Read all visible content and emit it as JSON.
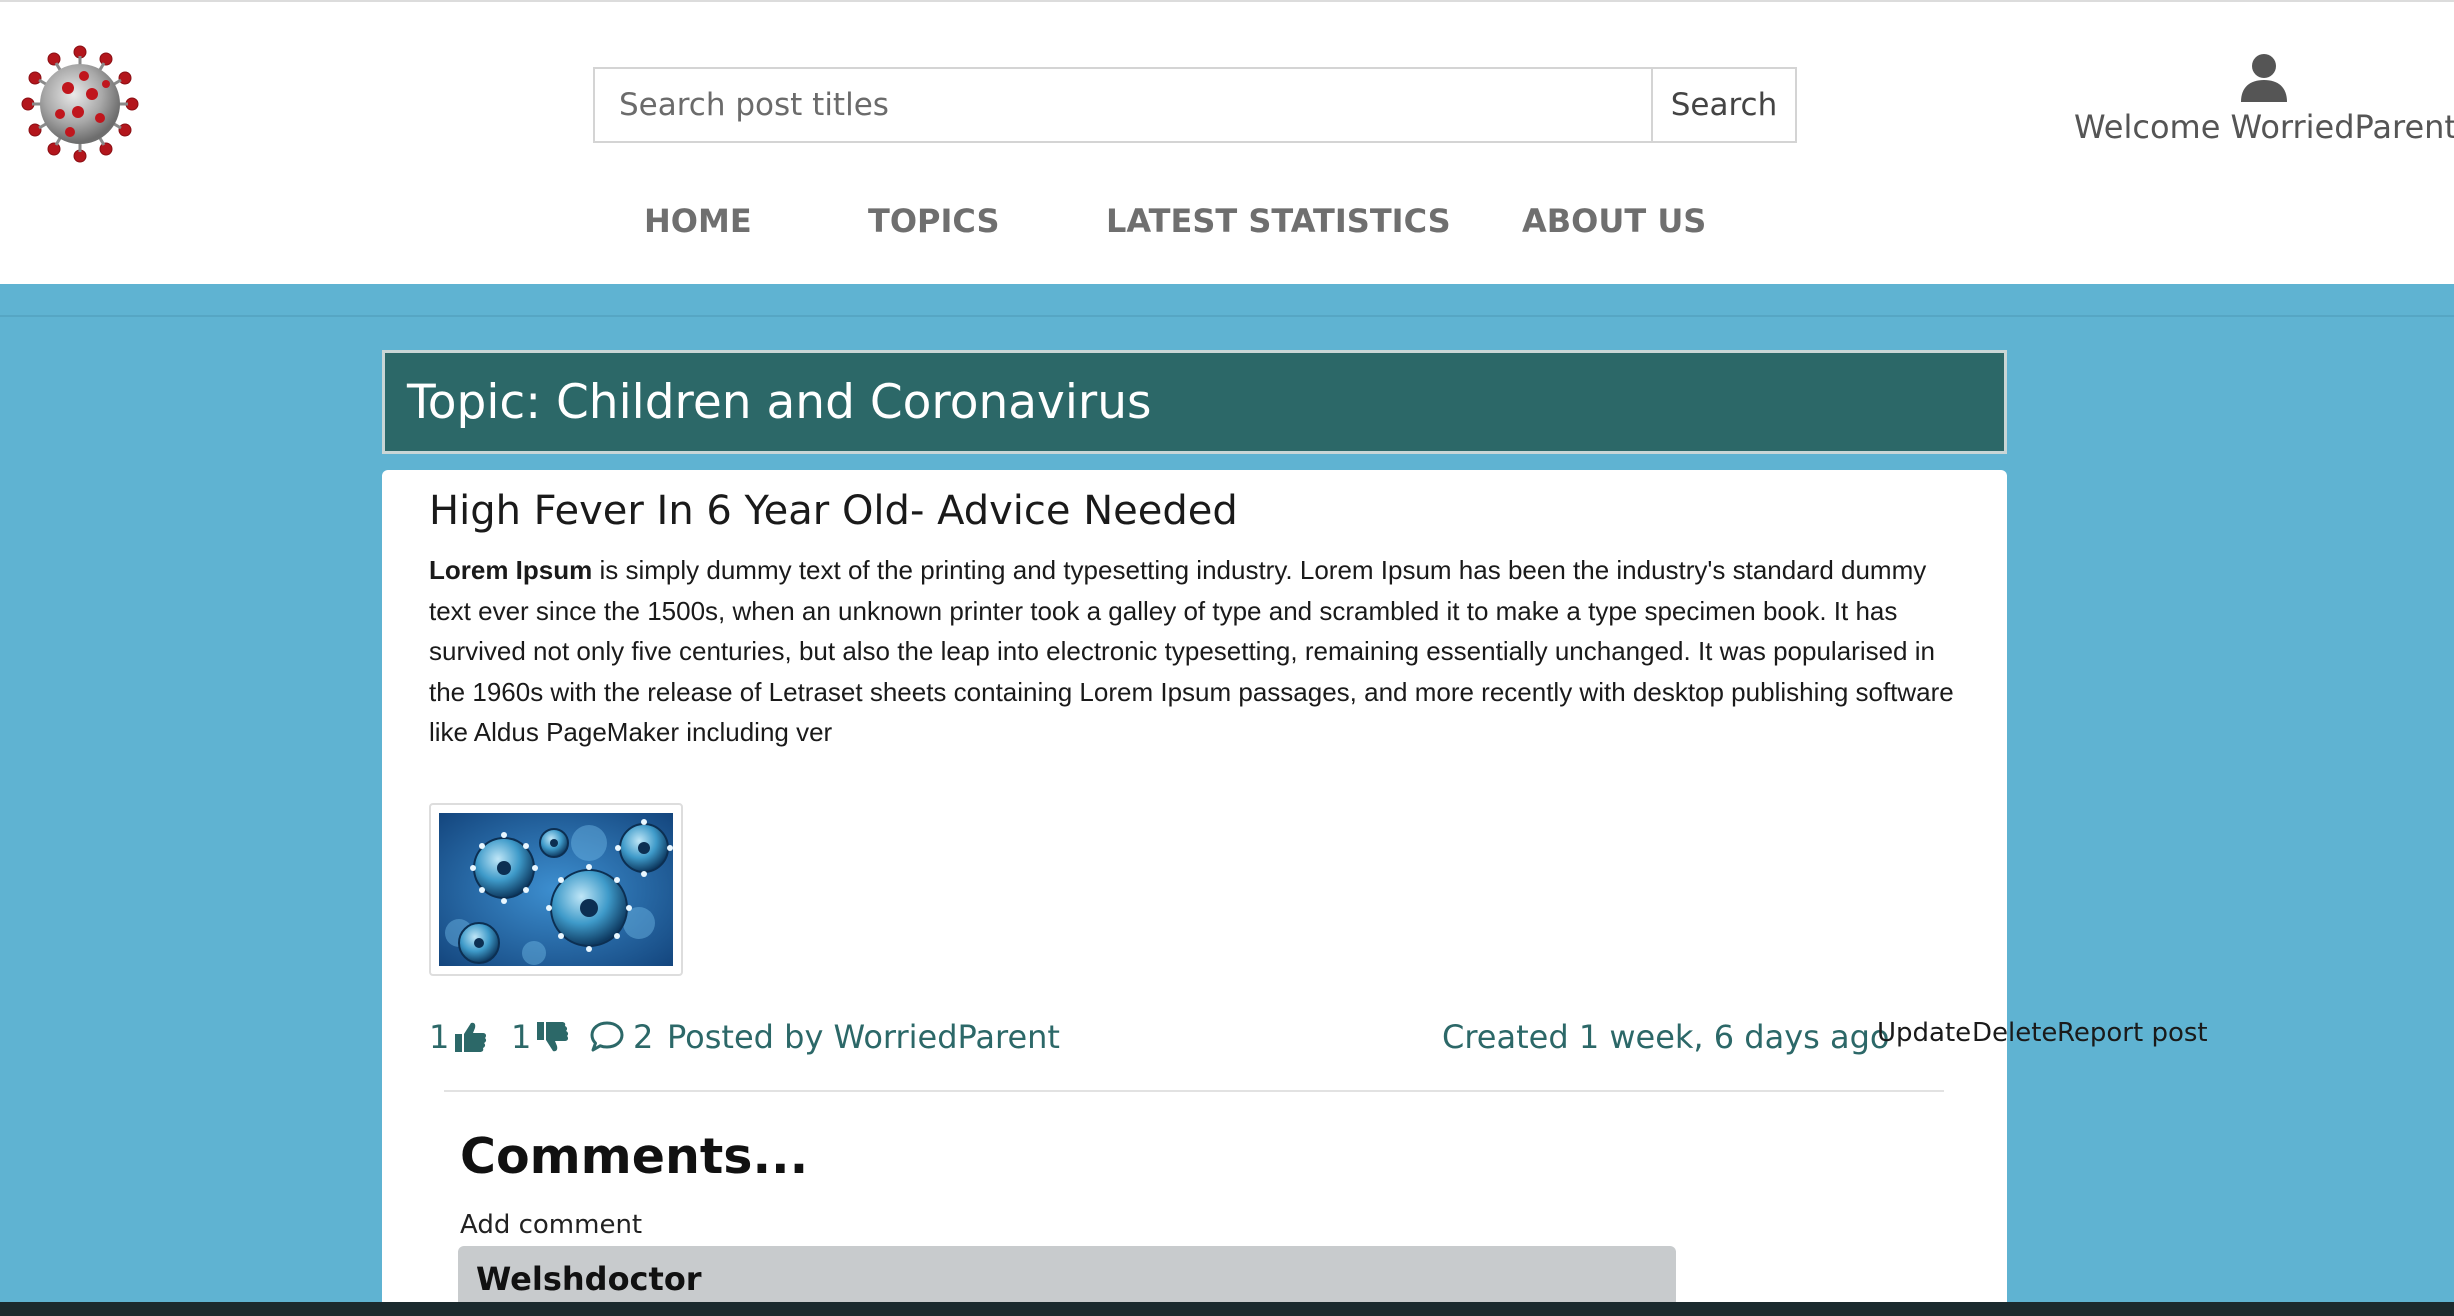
{
  "header": {
    "search": {
      "placeholder": "Search post titles",
      "button_label": "Search"
    },
    "user": {
      "icon": "user-icon",
      "welcome": "Welcome WorriedParent"
    },
    "nav": [
      {
        "label": "HOME"
      },
      {
        "label": "TOPICS"
      },
      {
        "label": "LATEST STATISTICS"
      },
      {
        "label": "ABOUT US"
      }
    ]
  },
  "topic": {
    "title": "Topic: Children and Coronavirus"
  },
  "post": {
    "title": "High Fever In 6 Year Old- Advice Needed",
    "body_lead": "Lorem Ipsum",
    "body_rest": " is simply dummy text of the printing and typesetting industry. Lorem Ipsum has been the industry's standard dummy text ever since the 1500s, when an unknown printer took a galley of type and scrambled it to make a type specimen book. It has survived not only five centuries, but also the leap into electronic typesetting, remaining essentially unchanged. It was popularised in the 1960s with the release of Letraset sheets containing Lorem Ipsum passages, and more recently with desktop publishing software like Aldus PageMaker including ver",
    "likes": "1",
    "dislikes": "1",
    "comment_count": "2",
    "posted_by": "Posted by WorriedParent",
    "created": "Created 1 week, 6 days ago",
    "actions": {
      "update": "Update",
      "delete": "Delete",
      "report": "Report post"
    }
  },
  "comments": {
    "heading": "Comments...",
    "add_label": "Add comment",
    "items": [
      {
        "author": "Welshdoctor"
      }
    ]
  },
  "colors": {
    "page_bg": "#5fb3d2",
    "banner_bg": "#2c6868",
    "accent_text": "#2c6868",
    "comment_bg": "#c8cbcd"
  }
}
